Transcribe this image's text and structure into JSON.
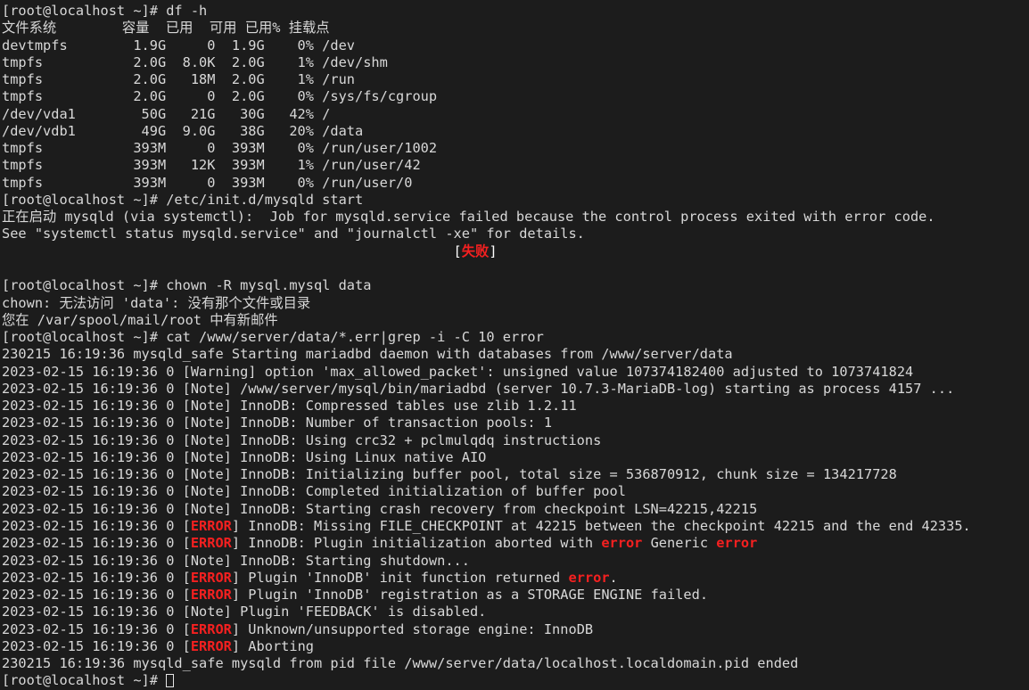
{
  "terminal": {
    "title": "root@localhost terminal",
    "prompt": "[root@localhost ~]# ",
    "background_color": "#1c1c1c",
    "foreground_color": "#d8d8d8",
    "error_color": "#f52020",
    "bracket_color": "#ffffff",
    "columns": 126,
    "rows": 39,
    "cursor": {
      "shape": "hollow-block",
      "row": 38,
      "column": 21
    },
    "commands": [
      "df -h",
      "/etc/init.d/mysqld start",
      "chown -R mysql.mysql data",
      "cat /www/server/data/*.err|grep -i -C 10 error"
    ],
    "df_table": {
      "headers": [
        "文件系统",
        "容量",
        "已用",
        "可用",
        "已用%",
        "挂载点"
      ],
      "rows": [
        {
          "filesystem": "devtmpfs",
          "size": "1.9G",
          "used": "0",
          "avail": "1.9G",
          "use_pct": "0%",
          "mounted_on": "/dev"
        },
        {
          "filesystem": "tmpfs",
          "size": "2.0G",
          "used": "8.0K",
          "avail": "2.0G",
          "use_pct": "1%",
          "mounted_on": "/dev/shm"
        },
        {
          "filesystem": "tmpfs",
          "size": "2.0G",
          "used": "18M",
          "avail": "2.0G",
          "use_pct": "1%",
          "mounted_on": "/run"
        },
        {
          "filesystem": "tmpfs",
          "size": "2.0G",
          "used": "0",
          "avail": "2.0G",
          "use_pct": "0%",
          "mounted_on": "/sys/fs/cgroup"
        },
        {
          "filesystem": "/dev/vda1",
          "size": "50G",
          "used": "21G",
          "avail": "30G",
          "use_pct": "42%",
          "mounted_on": "/"
        },
        {
          "filesystem": "/dev/vdb1",
          "size": "49G",
          "used": "9.0G",
          "avail": "38G",
          "use_pct": "20%",
          "mounted_on": "/data"
        },
        {
          "filesystem": "tmpfs",
          "size": "393M",
          "used": "0",
          "avail": "393M",
          "use_pct": "0%",
          "mounted_on": "/run/user/1002"
        },
        {
          "filesystem": "tmpfs",
          "size": "393M",
          "used": "12K",
          "avail": "393M",
          "use_pct": "1%",
          "mounted_on": "/run/user/42"
        },
        {
          "filesystem": "tmpfs",
          "size": "393M",
          "used": "0",
          "avail": "393M",
          "use_pct": "0%",
          "mounted_on": "/run/user/0"
        }
      ]
    },
    "lines": [
      {
        "id": "l00",
        "segments": [
          {
            "text": "[root@localhost ~]# df -h",
            "color": "default"
          }
        ]
      },
      {
        "id": "l01",
        "segments": [
          {
            "text": "文件系统        容量  已用  可用 已用% 挂载点",
            "color": "default"
          }
        ]
      },
      {
        "id": "l02",
        "segments": [
          {
            "text": "devtmpfs        1.9G     0  1.9G    0% /dev",
            "color": "default"
          }
        ]
      },
      {
        "id": "l03",
        "segments": [
          {
            "text": "tmpfs           2.0G  8.0K  2.0G    1% /dev/shm",
            "color": "default"
          }
        ]
      },
      {
        "id": "l04",
        "segments": [
          {
            "text": "tmpfs           2.0G   18M  2.0G    1% /run",
            "color": "default"
          }
        ]
      },
      {
        "id": "l05",
        "segments": [
          {
            "text": "tmpfs           2.0G     0  2.0G    0% /sys/fs/cgroup",
            "color": "default"
          }
        ]
      },
      {
        "id": "l06",
        "segments": [
          {
            "text": "/dev/vda1        50G   21G   30G   42% /",
            "color": "default"
          }
        ]
      },
      {
        "id": "l07",
        "segments": [
          {
            "text": "/dev/vdb1        49G  9.0G   38G   20% /data",
            "color": "default"
          }
        ]
      },
      {
        "id": "l08",
        "segments": [
          {
            "text": "tmpfs           393M     0  393M    0% /run/user/1002",
            "color": "default"
          }
        ]
      },
      {
        "id": "l09",
        "segments": [
          {
            "text": "tmpfs           393M   12K  393M    1% /run/user/42",
            "color": "default"
          }
        ]
      },
      {
        "id": "l10",
        "segments": [
          {
            "text": "tmpfs           393M     0  393M    0% /run/user/0",
            "color": "default"
          }
        ]
      },
      {
        "id": "l11",
        "segments": [
          {
            "text": "[root@localhost ~]# /etc/init.d/mysqld start",
            "color": "default"
          }
        ]
      },
      {
        "id": "l12",
        "segments": [
          {
            "text": "正在启动 mysqld (via systemctl):  Job for mysqld.service failed because the control process exited with error code.",
            "color": "default"
          }
        ]
      },
      {
        "id": "l13",
        "segments": [
          {
            "text": "See \"systemctl status mysqld.service\" and \"journalctl -xe\" for details.",
            "color": "default"
          }
        ]
      },
      {
        "id": "l14",
        "segments": [
          {
            "text": "                                                       [",
            "color": "white"
          },
          {
            "text": "失败",
            "color": "red"
          },
          {
            "text": "]",
            "color": "white"
          }
        ]
      },
      {
        "id": "l15",
        "segments": [
          {
            "text": "",
            "color": "default"
          }
        ]
      },
      {
        "id": "l16",
        "segments": [
          {
            "text": "[root@localhost ~]# chown -R mysql.mysql data",
            "color": "default"
          }
        ]
      },
      {
        "id": "l17",
        "segments": [
          {
            "text": "chown: 无法访问 'data': 没有那个文件或目录",
            "color": "default"
          }
        ]
      },
      {
        "id": "l18",
        "segments": [
          {
            "text": "您在 /var/spool/mail/root 中有新邮件",
            "color": "default"
          }
        ]
      },
      {
        "id": "l19",
        "segments": [
          {
            "text": "[root@localhost ~]# cat /www/server/data/*.err|grep -i -C 10 error",
            "color": "default"
          }
        ]
      },
      {
        "id": "l20",
        "segments": [
          {
            "text": "230215 16:19:36 mysqld_safe Starting mariadbd daemon with databases from /www/server/data",
            "color": "default"
          }
        ]
      },
      {
        "id": "l21",
        "segments": [
          {
            "text": "2023-02-15 16:19:36 0 [Warning] option 'max_allowed_packet': unsigned value 107374182400 adjusted to 1073741824",
            "color": "default"
          }
        ]
      },
      {
        "id": "l22",
        "segments": [
          {
            "text": "2023-02-15 16:19:36 0 [Note] /www/server/mysql/bin/mariadbd (server 10.7.3-MariaDB-log) starting as process 4157 ...",
            "color": "default"
          }
        ]
      },
      {
        "id": "l23",
        "segments": [
          {
            "text": "2023-02-15 16:19:36 0 [Note] InnoDB: Compressed tables use zlib 1.2.11",
            "color": "default"
          }
        ]
      },
      {
        "id": "l24",
        "segments": [
          {
            "text": "2023-02-15 16:19:36 0 [Note] InnoDB: Number of transaction pools: 1",
            "color": "default"
          }
        ]
      },
      {
        "id": "l25",
        "segments": [
          {
            "text": "2023-02-15 16:19:36 0 [Note] InnoDB: Using crc32 + pclmulqdq instructions",
            "color": "default"
          }
        ]
      },
      {
        "id": "l26",
        "segments": [
          {
            "text": "2023-02-15 16:19:36 0 [Note] InnoDB: Using Linux native AIO",
            "color": "default"
          }
        ]
      },
      {
        "id": "l27",
        "segments": [
          {
            "text": "2023-02-15 16:19:36 0 [Note] InnoDB: Initializing buffer pool, total size = 536870912, chunk size = 134217728",
            "color": "default"
          }
        ]
      },
      {
        "id": "l28",
        "segments": [
          {
            "text": "2023-02-15 16:19:36 0 [Note] InnoDB: Completed initialization of buffer pool",
            "color": "default"
          }
        ]
      },
      {
        "id": "l29",
        "segments": [
          {
            "text": "2023-02-15 16:19:36 0 [Note] InnoDB: Starting crash recovery from checkpoint LSN=42215,42215",
            "color": "default"
          }
        ]
      },
      {
        "id": "l30",
        "segments": [
          {
            "text": "2023-02-15 16:19:36 0 [",
            "color": "default"
          },
          {
            "text": "ERROR",
            "color": "red"
          },
          {
            "text": "] InnoDB: Missing FILE_CHECKPOINT at 42215 between the checkpoint 42215 and the end 42335.",
            "color": "default"
          }
        ]
      },
      {
        "id": "l31",
        "segments": [
          {
            "text": "2023-02-15 16:19:36 0 [",
            "color": "default"
          },
          {
            "text": "ERROR",
            "color": "red"
          },
          {
            "text": "] InnoDB: Plugin initialization aborted with ",
            "color": "default"
          },
          {
            "text": "error",
            "color": "red"
          },
          {
            "text": " Generic ",
            "color": "default"
          },
          {
            "text": "error",
            "color": "red"
          }
        ]
      },
      {
        "id": "l32",
        "segments": [
          {
            "text": "2023-02-15 16:19:36 0 [Note] InnoDB: Starting shutdown...",
            "color": "default"
          }
        ]
      },
      {
        "id": "l33",
        "segments": [
          {
            "text": "2023-02-15 16:19:36 0 [",
            "color": "default"
          },
          {
            "text": "ERROR",
            "color": "red"
          },
          {
            "text": "] Plugin 'InnoDB' init function returned ",
            "color": "default"
          },
          {
            "text": "error",
            "color": "red"
          },
          {
            "text": ".",
            "color": "default"
          }
        ]
      },
      {
        "id": "l34",
        "segments": [
          {
            "text": "2023-02-15 16:19:36 0 [",
            "color": "default"
          },
          {
            "text": "ERROR",
            "color": "red"
          },
          {
            "text": "] Plugin 'InnoDB' registration as a STORAGE ENGINE failed.",
            "color": "default"
          }
        ]
      },
      {
        "id": "l35",
        "segments": [
          {
            "text": "2023-02-15 16:19:36 0 [Note] Plugin 'FEEDBACK' is disabled.",
            "color": "default"
          }
        ]
      },
      {
        "id": "l36",
        "segments": [
          {
            "text": "2023-02-15 16:19:36 0 [",
            "color": "default"
          },
          {
            "text": "ERROR",
            "color": "red"
          },
          {
            "text": "] Unknown/unsupported storage engine: InnoDB",
            "color": "default"
          }
        ]
      },
      {
        "id": "l37",
        "segments": [
          {
            "text": "2023-02-15 16:19:36 0 [",
            "color": "default"
          },
          {
            "text": "ERROR",
            "color": "red"
          },
          {
            "text": "] Aborting",
            "color": "default"
          }
        ]
      },
      {
        "id": "l38",
        "segments": [
          {
            "text": "230215 16:19:36 mysqld_safe mysqld from pid file /www/server/data/localhost.localdomain.pid ended",
            "color": "default"
          }
        ]
      },
      {
        "id": "l39",
        "segments": [
          {
            "text": "[root@localhost ~]# ",
            "color": "default"
          },
          {
            "text": "",
            "color": "cursor"
          }
        ]
      }
    ]
  }
}
